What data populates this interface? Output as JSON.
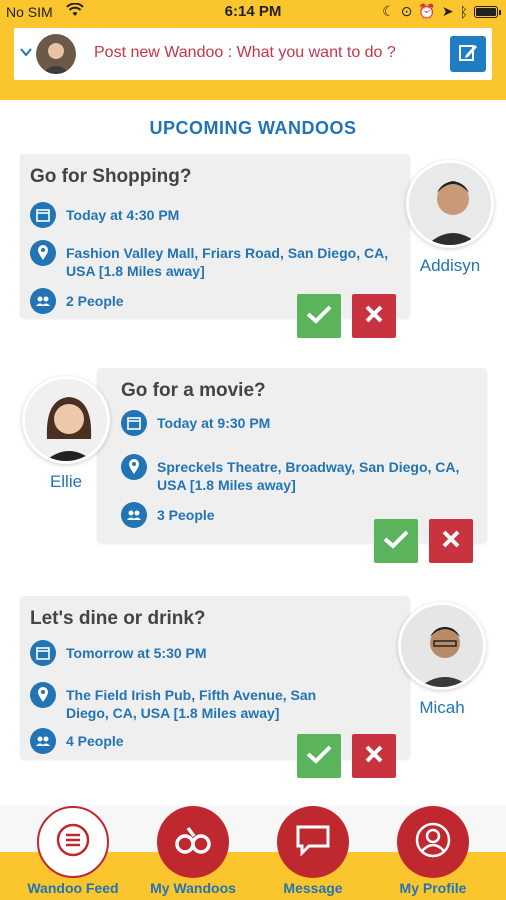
{
  "status_bar": {
    "carrier": "No SIM",
    "time": "6:14 PM"
  },
  "header": {
    "prompt": "Post new Wandoo : What you want to do ?"
  },
  "section_title": "UPCOMING WANDOOS",
  "cards": [
    {
      "title": "Go for Shopping?",
      "time": "Today at 4:30 PM",
      "location": "Fashion Valley Mall, Friars Road, San Diego, CA, USA [1.8 Miles away]",
      "people": "2 People",
      "person_name": "Addisyn"
    },
    {
      "title": "Go for a movie?",
      "time": "Today at 9:30 PM",
      "location": "Spreckels Theatre, Broadway, San Diego, CA, USA [1.8 Miles away]",
      "people": "3 People",
      "person_name": "Ellie"
    },
    {
      "title": "Let's dine or drink?",
      "time": "Tomorrow at 5:30 PM",
      "location": "The Field Irish Pub, Fifth Avenue, San Diego, CA, USA [1.8 Miles away]",
      "people": "4 People",
      "person_name": "Micah"
    }
  ],
  "nav": [
    {
      "label": "Wandoo Feed",
      "icon": "list-icon",
      "active": true
    },
    {
      "label": "My Wandoos",
      "icon": "wandoo-logo-icon",
      "active": false
    },
    {
      "label": "Message",
      "icon": "chat-bubble-icon",
      "active": false
    },
    {
      "label": "My Profile",
      "icon": "profile-icon",
      "active": false
    }
  ],
  "colors": {
    "header_yellow": "#fbc52d",
    "primary_blue": "#2274b5",
    "accent_red": "#c0282f",
    "accept_green": "#5bb35b"
  }
}
